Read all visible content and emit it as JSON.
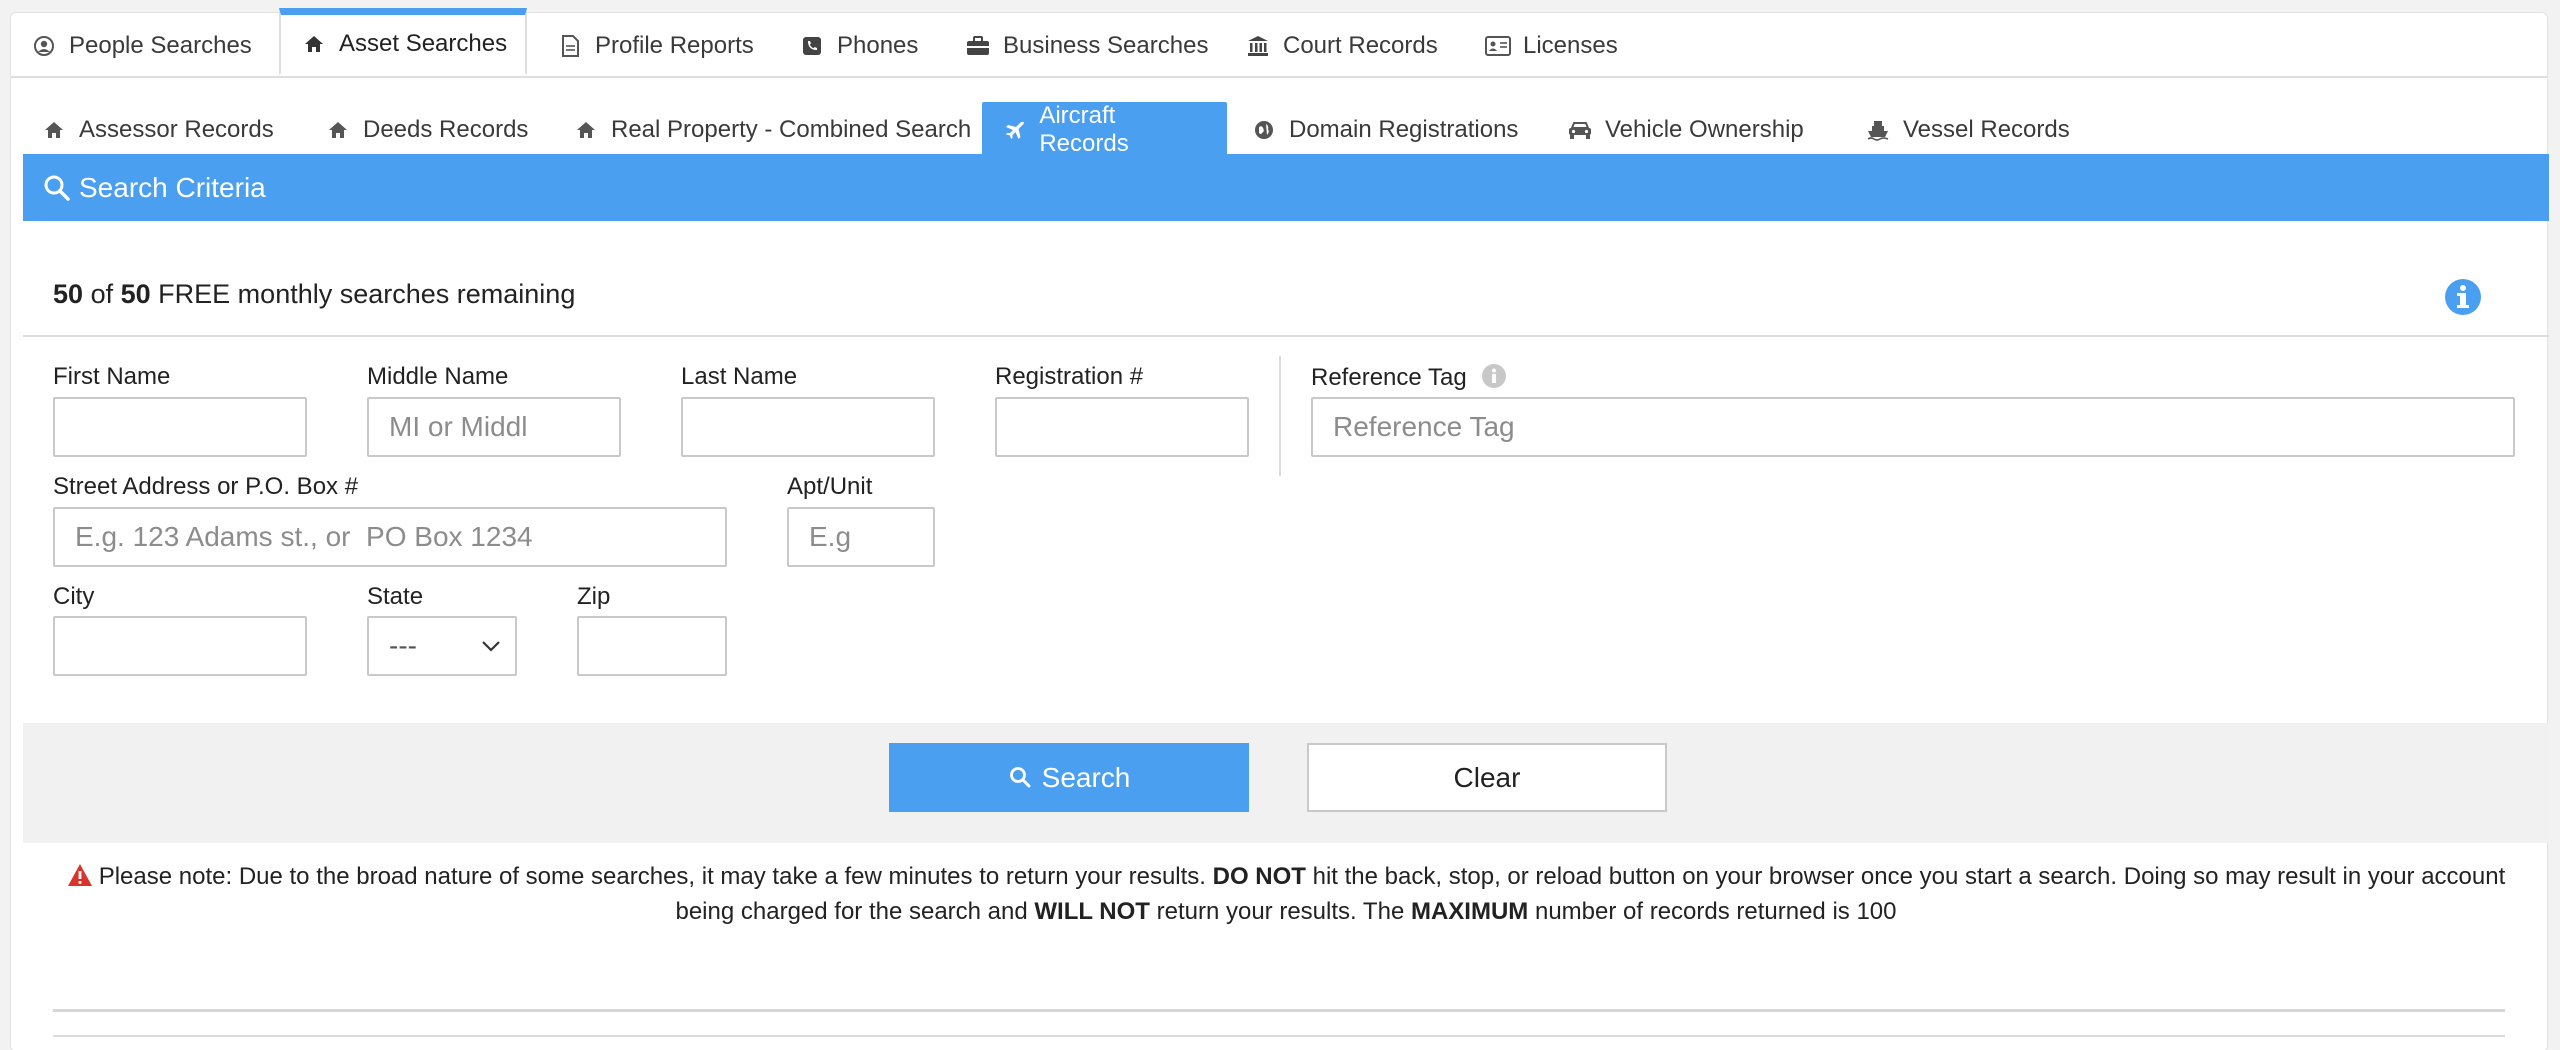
{
  "main_tabs": [
    {
      "label": "People Searches",
      "icon": "user-circle-icon"
    },
    {
      "label": "Asset Searches",
      "icon": "home-icon"
    },
    {
      "label": "Profile Reports",
      "icon": "document-icon"
    },
    {
      "label": "Phones",
      "icon": "phone-icon"
    },
    {
      "label": "Business Searches",
      "icon": "briefcase-icon"
    },
    {
      "label": "Court Records",
      "icon": "courthouse-icon"
    },
    {
      "label": "Licenses",
      "icon": "id-card-icon"
    }
  ],
  "sub_tabs": [
    {
      "label": "Assessor Records",
      "icon": "home-icon"
    },
    {
      "label": "Deeds Records",
      "icon": "home-icon"
    },
    {
      "label": "Real Property - Combined Search",
      "icon": "home-icon"
    },
    {
      "label": "Aircraft Records",
      "icon": "plane-icon"
    },
    {
      "label": "Domain Registrations",
      "icon": "globe-icon"
    },
    {
      "label": "Vehicle Ownership",
      "icon": "car-icon"
    },
    {
      "label": "Vessel Records",
      "icon": "ship-icon"
    }
  ],
  "active_main_tab": "Asset Searches",
  "active_sub_tab": "Aircraft Records",
  "criteria": {
    "title": "Search Criteria"
  },
  "remaining": {
    "used": "50",
    "of": "of",
    "total": "50",
    "suffix": "FREE monthly searches remaining"
  },
  "fields": {
    "first_name": {
      "label": "First Name",
      "placeholder": "",
      "value": ""
    },
    "middle_name": {
      "label": "Middle Name",
      "placeholder": "MI or Middl",
      "value": ""
    },
    "last_name": {
      "label": "Last Name",
      "placeholder": "",
      "value": ""
    },
    "registration": {
      "label": "Registration #",
      "placeholder": "",
      "value": ""
    },
    "reference_tag": {
      "label": "Reference Tag",
      "placeholder": "Reference Tag",
      "value": ""
    },
    "street": {
      "label": "Street Address or P.O. Box #",
      "placeholder": "E.g. 123 Adams st., or  PO Box 1234",
      "value": ""
    },
    "apt": {
      "label": "Apt/Unit",
      "placeholder": "E.g",
      "value": ""
    },
    "city": {
      "label": "City",
      "placeholder": "",
      "value": ""
    },
    "state": {
      "label": "State",
      "selected": "---"
    },
    "zip": {
      "label": "Zip",
      "placeholder": "",
      "value": ""
    }
  },
  "buttons": {
    "search": "Search",
    "clear": "Clear"
  },
  "note": {
    "p1": "Please note: Due to the broad nature of some searches, it may take a few minutes to return your results.",
    "b1": "DO NOT",
    "p2": "hit the back, stop, or reload button on your browser once you start a search. Doing so may result in your account being charged for the search and",
    "b2": "WILL NOT",
    "p3": "return your results. The",
    "b3": "MAXIMUM",
    "p4": "number of records returned is 100"
  },
  "colors": {
    "accent": "#4b9ff0",
    "warning": "#d9342b"
  }
}
